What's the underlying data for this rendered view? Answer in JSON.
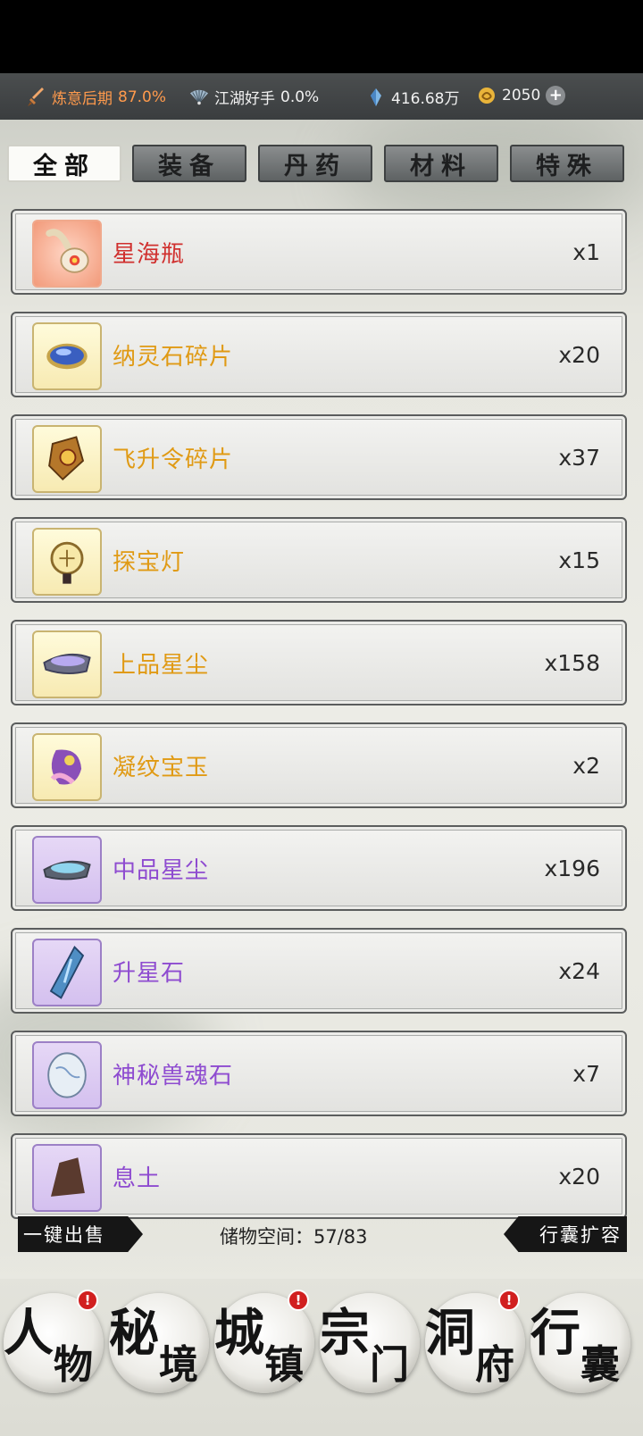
{
  "status": {
    "realm_label": "炼意后期",
    "realm_value": "87.0%",
    "title_label": "江湖好手",
    "title_value": "0.0%",
    "spirit_stones": "416.68万",
    "gold": "2050",
    "plus": "+"
  },
  "tabs": [
    {
      "label": "全部",
      "active": true
    },
    {
      "label": "装备",
      "active": false
    },
    {
      "label": "丹药",
      "active": false
    },
    {
      "label": "材料",
      "active": false
    },
    {
      "label": "特殊",
      "active": false
    }
  ],
  "items": [
    {
      "name": "星海瓶",
      "qty": "x1",
      "rarity": "red",
      "icon": "bottle-icon"
    },
    {
      "name": "纳灵石碎片",
      "qty": "x20",
      "rarity": "gold",
      "icon": "blue-stone-fragment-icon"
    },
    {
      "name": "飞升令碎片",
      "qty": "x37",
      "rarity": "gold",
      "icon": "token-fragment-icon"
    },
    {
      "name": "探宝灯",
      "qty": "x15",
      "rarity": "gold",
      "icon": "lantern-icon"
    },
    {
      "name": "上品星尘",
      "qty": "x158",
      "rarity": "gold",
      "icon": "stardust-icon"
    },
    {
      "name": "凝纹宝玉",
      "qty": "x2",
      "rarity": "gold",
      "icon": "jade-icon"
    },
    {
      "name": "中品星尘",
      "qty": "x196",
      "rarity": "purple",
      "icon": "stardust-icon"
    },
    {
      "name": "升星石",
      "qty": "x24",
      "rarity": "purple",
      "icon": "star-stone-icon"
    },
    {
      "name": "神秘兽魂石",
      "qty": "x7",
      "rarity": "purple",
      "icon": "beast-soul-stone-icon"
    },
    {
      "name": "息土",
      "qty": "x20",
      "rarity": "purple",
      "icon": "soil-icon"
    }
  ],
  "footer": {
    "sell_all": "一键出售",
    "storage_label": "储物空间：",
    "storage_value": "57/83",
    "expand": "行囊扩容"
  },
  "nav": [
    {
      "c1": "人",
      "c2": "物",
      "badge": "!"
    },
    {
      "c1": "秘",
      "c2": "境",
      "badge": ""
    },
    {
      "c1": "城",
      "c2": "镇",
      "badge": "!"
    },
    {
      "c1": "宗",
      "c2": "门",
      "badge": ""
    },
    {
      "c1": "洞",
      "c2": "府",
      "badge": "!"
    },
    {
      "c1": "行",
      "c2": "囊",
      "badge": ""
    }
  ],
  "colors": {
    "rarity_red": "#d0302e",
    "rarity_gold": "#e09a14",
    "rarity_purple": "#8e4bd0",
    "realm_accent": "#ff9a4c",
    "badge": "#d11f1f"
  }
}
